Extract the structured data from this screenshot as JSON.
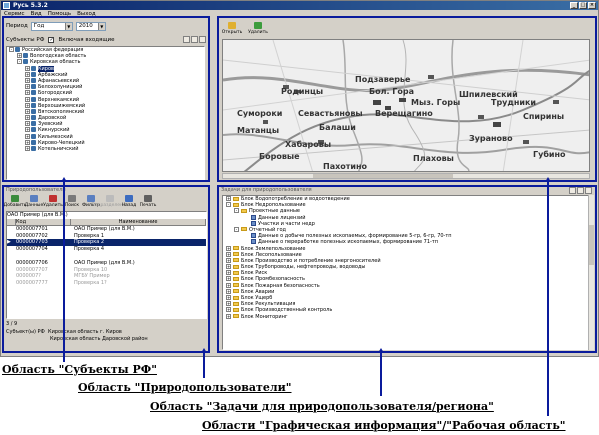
{
  "window": {
    "title": "Русь 5.3.2",
    "buttons": [
      "_",
      "□",
      "×"
    ]
  },
  "menu": [
    "Сервис",
    "Вид",
    "Помощь",
    "Выход"
  ],
  "subjects_panel": {
    "period_label": "Период",
    "period_value": "Год",
    "year_value": "2010",
    "subjects_label": "Субъекты РФ",
    "include_label": "Включая входящие",
    "tree": [
      {
        "label": "Российская федерация",
        "level": 0,
        "pm": "-"
      },
      {
        "label": "Вологодская область",
        "level": 1,
        "pm": "+"
      },
      {
        "label": "Кировская область",
        "level": 1,
        "pm": "-"
      },
      {
        "label": "Киров",
        "level": 2,
        "pm": "+",
        "selected": true
      },
      {
        "label": "Арбажский",
        "level": 2,
        "pm": "+"
      },
      {
        "label": "Афанасьевский",
        "level": 2,
        "pm": "+"
      },
      {
        "label": "Белохолуницкий",
        "level": 2,
        "pm": "+"
      },
      {
        "label": "Богородский",
        "level": 2,
        "pm": "+"
      },
      {
        "label": "Верхнекамский",
        "level": 2,
        "pm": "+"
      },
      {
        "label": "Верхошижемский",
        "level": 2,
        "pm": "+"
      },
      {
        "label": "Вятскополянский",
        "level": 2,
        "pm": "+"
      },
      {
        "label": "Даровской",
        "level": 2,
        "pm": "+"
      },
      {
        "label": "Зуевский",
        "level": 2,
        "pm": "+"
      },
      {
        "label": "Кикнурский",
        "level": 2,
        "pm": "+"
      },
      {
        "label": "Кильмезский",
        "level": 2,
        "pm": "+"
      },
      {
        "label": "Кирово-Чепецкий",
        "level": 2,
        "pm": "+"
      },
      {
        "label": "Котельничский",
        "level": 2,
        "pm": "+"
      }
    ]
  },
  "users_panel": {
    "title": "Природопользователи",
    "toolbar": [
      {
        "label": "Добавить",
        "color": "#3c8c3c",
        "disabled": false
      },
      {
        "label": "Данные",
        "color": "#5a7fc0",
        "disabled": false
      },
      {
        "label": "Удалить",
        "color": "#c03030",
        "disabled": false
      },
      {
        "label": "Поиск",
        "color": "#7a7a7a",
        "disabled": false
      },
      {
        "label": "Фильтр",
        "color": "#5a7fc0",
        "disabled": false
      },
      {
        "label": "Подразделение",
        "color": "#bbbbbb",
        "disabled": true
      },
      {
        "label": "Назад",
        "color": "#3c6cc0",
        "disabled": false
      },
      {
        "label": "Печать",
        "color": "#606060",
        "disabled": false
      }
    ],
    "org_line": "ОАО Пример (для В.М.)",
    "columns": [
      "Код",
      "Наименование"
    ],
    "rows": [
      {
        "code": "0000007701",
        "name": "ОАО Пример (для В.М.)",
        "style": ""
      },
      {
        "code": "0000007702",
        "name": "Проверка 1",
        "style": ""
      },
      {
        "code": "0000007703",
        "name": "Проверка 2",
        "style": "sel"
      },
      {
        "code": "0000007704",
        "name": "Проверка 4",
        "style": ""
      },
      {
        "code": "",
        "name": "",
        "style": "gap"
      },
      {
        "code": "0000007706",
        "name": "ОАО Пример (для В.М.)",
        "style": ""
      },
      {
        "code": "0000007707",
        "name": "Проверка 10",
        "style": "gray"
      },
      {
        "code": "0000007?",
        "name": "МГБУ Пример",
        "style": "gray"
      },
      {
        "code": "0000007777",
        "name": "Проверка 1?",
        "style": "gray"
      }
    ],
    "status": "3 / 9"
  },
  "bottom_info": {
    "line1_label": "Субъект(ы) РФ",
    "line1_value": "Кировская область г. Киров",
    "line2_value": "Кировская область Даровской район"
  },
  "map_panel": {
    "tools": [
      {
        "label": "Открыть",
        "color": "#e0b030"
      },
      {
        "label": "Удалить",
        "color": "#3c9c3c"
      }
    ],
    "labels": [
      "Подзаверье",
      "Родинцы",
      "Бол. Гора",
      "Шпилевский",
      "Сумороки",
      "Севастьяновы",
      "Верещагино",
      "Спирины",
      "Балаши",
      "Матанцы",
      "Хабаровы",
      "Боровые",
      "Пахотино",
      "Плаховы",
      "Мыз. Горы",
      "Трудники",
      "Зураново",
      "Губино"
    ]
  },
  "tasks_panel": {
    "title": "Задачи для природопользователя",
    "tree": [
      {
        "label": "Блок Водопотребление и водоотведение",
        "level": 0,
        "pm": "+",
        "icon": "fold"
      },
      {
        "label": "Блок Недропользование",
        "level": 0,
        "pm": "-",
        "icon": "fold"
      },
      {
        "label": "Проектные данные",
        "level": 1,
        "pm": "-",
        "icon": "fold"
      },
      {
        "label": "Данные лицензий",
        "level": 2,
        "pm": "",
        "icon": "doc"
      },
      {
        "label": "Участки и части недр",
        "level": 2,
        "pm": "",
        "icon": "doc"
      },
      {
        "label": "Отчетный год",
        "level": 1,
        "pm": "-",
        "icon": "fold"
      },
      {
        "label": "Данные о добыче полезных ископаемых, формирование 5-гр, 6-гр, 70-тп",
        "level": 2,
        "pm": "",
        "icon": "doc"
      },
      {
        "label": "Данные о переработке полезных ископаемых, формирование 71-тп",
        "level": 2,
        "pm": "",
        "icon": "doc"
      },
      {
        "label": "Блок Землепользование",
        "level": 0,
        "pm": "+",
        "icon": "fold"
      },
      {
        "label": "Блок Лесопользование",
        "level": 0,
        "pm": "+",
        "icon": "fold"
      },
      {
        "label": "Блок Производство и потребление энергоносителей",
        "level": 0,
        "pm": "+",
        "icon": "fold"
      },
      {
        "label": "Блок Трубопроводы, нефтепроводы, водоводы",
        "level": 0,
        "pm": "+",
        "icon": "fold"
      },
      {
        "label": "Блок Риск",
        "level": 0,
        "pm": "+",
        "icon": "fold"
      },
      {
        "label": "Блок Промбезопасность",
        "level": 0,
        "pm": "+",
        "icon": "fold"
      },
      {
        "label": "Блок Пожарная безопасность",
        "level": 0,
        "pm": "+",
        "icon": "fold"
      },
      {
        "label": "Блок Аварии",
        "level": 0,
        "pm": "+",
        "icon": "fold"
      },
      {
        "label": "Блок Ущерб",
        "level": 0,
        "pm": "+",
        "icon": "fold"
      },
      {
        "label": "Блок Рекультивация",
        "level": 0,
        "pm": "+",
        "icon": "fold"
      },
      {
        "label": "Блок Производственный контроль",
        "level": 0,
        "pm": "+",
        "icon": "fold"
      },
      {
        "label": "Блок Мониторинг",
        "level": 0,
        "pm": "+",
        "icon": "fold"
      }
    ]
  },
  "captions": {
    "subjects": "Область \"Субъекты РФ\"",
    "users": "Область \"Природопользователи\"",
    "tasks": "Область \"Задачи для природопользователя/региона\"",
    "graphics": "Области \"Графическая информация\"/\"Рабочая область\""
  },
  "colors": {
    "highlight": "#0a1b9c",
    "selection": "#0a246a",
    "window_bg": "#d4d0c8"
  }
}
